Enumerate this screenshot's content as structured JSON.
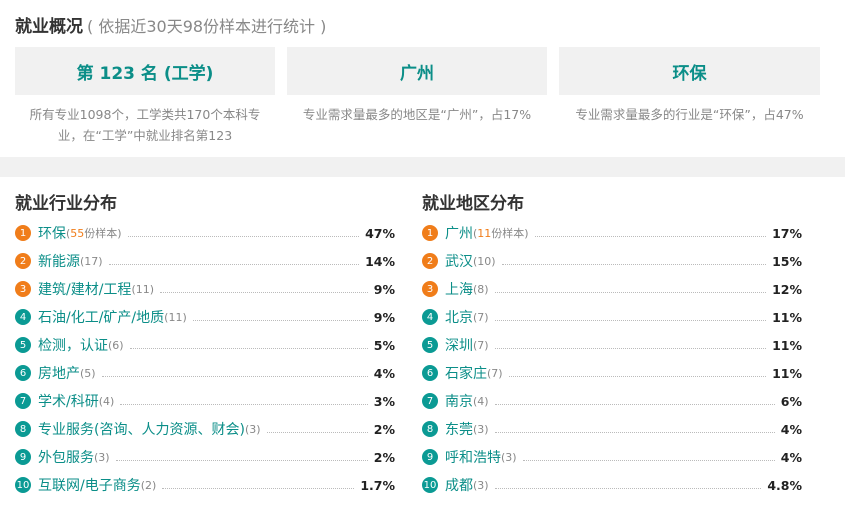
{
  "overview": {
    "title": "就业概况",
    "subtitle": "( 依据近30天98份样本进行统计 )",
    "cards": [
      {
        "label": "第 123 名 (工学)",
        "desc_line1": "所有专业1098个，工学类共170个本科专",
        "desc_line2": "业，在“工学”中就业排名第123"
      },
      {
        "label": "广州",
        "desc_line1": "专业需求量最多的地区是“广州”，占17%",
        "desc_line2": ""
      },
      {
        "label": "环保",
        "desc_line1": "专业需求量最多的行业是“环保”，占47%",
        "desc_line2": ""
      }
    ]
  },
  "industry": {
    "title": "就业行业分布",
    "first_count_prefix": "(",
    "first_count_num": "55",
    "first_count_suffix": "份样本)",
    "items": [
      {
        "rank": "1",
        "name": "环保",
        "count": "",
        "pct": "47%"
      },
      {
        "rank": "2",
        "name": "新能源",
        "count": "(17)",
        "pct": "14%"
      },
      {
        "rank": "3",
        "name": "建筑/建材/工程",
        "count": "(11)",
        "pct": "9%"
      },
      {
        "rank": "4",
        "name": "石油/化工/矿产/地质",
        "count": "(11)",
        "pct": "9%"
      },
      {
        "rank": "5",
        "name": "检测，认证",
        "count": "(6)",
        "pct": "5%"
      },
      {
        "rank": "6",
        "name": "房地产",
        "count": "(5)",
        "pct": "4%"
      },
      {
        "rank": "7",
        "name": "学术/科研",
        "count": "(4)",
        "pct": "3%"
      },
      {
        "rank": "8",
        "name": "专业服务(咨询、人力资源、财会)",
        "count": "(3)",
        "pct": "2%"
      },
      {
        "rank": "9",
        "name": "外包服务",
        "count": "(3)",
        "pct": "2%"
      },
      {
        "rank": "10",
        "name": "互联网/电子商务",
        "count": "(2)",
        "pct": "1.7%"
      }
    ]
  },
  "region": {
    "title": "就业地区分布",
    "first_count_prefix": "(",
    "first_count_num": "11",
    "first_count_suffix": "份样本)",
    "items": [
      {
        "rank": "1",
        "name": "广州",
        "count": "",
        "pct": "17%"
      },
      {
        "rank": "2",
        "name": "武汉",
        "count": "(10)",
        "pct": "15%"
      },
      {
        "rank": "3",
        "name": "上海",
        "count": "(8)",
        "pct": "12%"
      },
      {
        "rank": "4",
        "name": "北京",
        "count": "(7)",
        "pct": "11%"
      },
      {
        "rank": "5",
        "name": "深圳",
        "count": "(7)",
        "pct": "11%"
      },
      {
        "rank": "6",
        "name": "石家庄",
        "count": "(7)",
        "pct": "11%"
      },
      {
        "rank": "7",
        "name": "南京",
        "count": "(4)",
        "pct": "6%"
      },
      {
        "rank": "8",
        "name": "东莞",
        "count": "(3)",
        "pct": "4%"
      },
      {
        "rank": "9",
        "name": "呼和浩特",
        "count": "(3)",
        "pct": "4%"
      },
      {
        "rank": "10",
        "name": "成都",
        "count": "(3)",
        "pct": "4.8%"
      }
    ]
  },
  "colors": {
    "accent": "#0b8e88",
    "rank_top": "#f07d1a",
    "rank_other": "#0b9a94"
  }
}
